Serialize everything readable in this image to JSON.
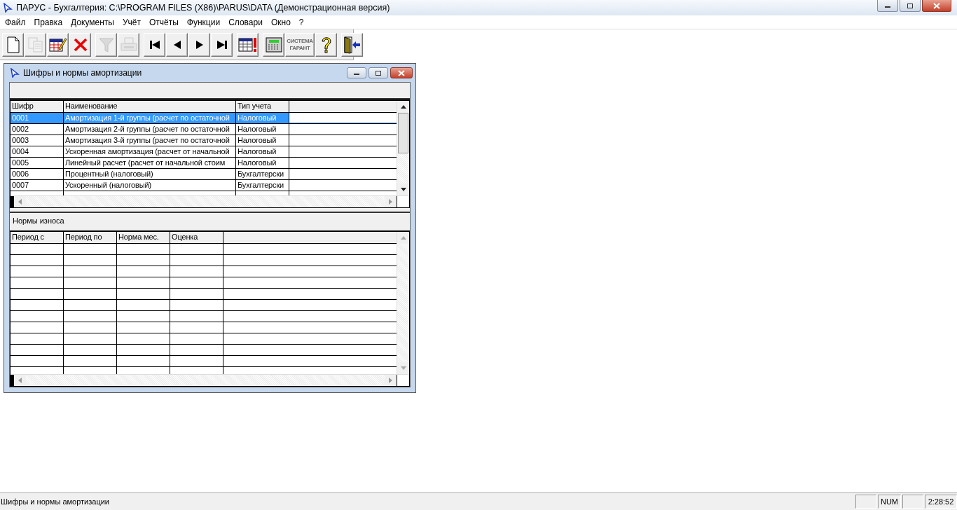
{
  "window": {
    "title": "ПАРУС - Бухгалтерия: C:\\PROGRAM FILES (X86)\\PARUS\\DATA (Демонстрационная версия)"
  },
  "menu": [
    {
      "label": "Файл"
    },
    {
      "label": "Правка"
    },
    {
      "label": "Документы"
    },
    {
      "label": "Учёт"
    },
    {
      "label": "Отчёты"
    },
    {
      "label": "Функции"
    },
    {
      "label": "Словари"
    },
    {
      "label": "Окно"
    },
    {
      "label": "?"
    }
  ],
  "toolbar": [
    [
      {
        "kind": "new",
        "disabled": false
      },
      {
        "kind": "copy",
        "disabled": true
      },
      {
        "kind": "edit",
        "disabled": false
      },
      {
        "kind": "delete",
        "disabled": false
      }
    ],
    [
      {
        "kind": "filter",
        "disabled": true
      },
      {
        "kind": "print",
        "disabled": true
      }
    ],
    [
      {
        "kind": "first",
        "disabled": false
      },
      {
        "kind": "prev",
        "disabled": false
      },
      {
        "kind": "next",
        "disabled": false
      },
      {
        "kind": "last",
        "disabled": false
      }
    ],
    [
      {
        "kind": "alert",
        "disabled": false
      }
    ],
    [
      {
        "kind": "calculator",
        "disabled": false
      },
      {
        "kind": "garant",
        "disabled": true,
        "label_lines": [
          "СИСТЕМА",
          "ГАРАНТ"
        ]
      },
      {
        "kind": "help",
        "disabled": false
      }
    ],
    [
      {
        "kind": "exit",
        "disabled": false
      }
    ]
  ],
  "child_window": {
    "title": "Шифры и нормы амортизации",
    "table": {
      "columns": [
        {
          "label": "Шифр"
        },
        {
          "label": "Наименование"
        },
        {
          "label": "Тип учета"
        }
      ],
      "rows": [
        {
          "cells": [
            "0001",
            "Амортизация 1-й группы (расчет по остаточной",
            "Налоговый"
          ],
          "selected": true
        },
        {
          "cells": [
            "0002",
            "Амортизация 2-й группы (расчет по остаточной",
            "Налоговый"
          ],
          "selected": false
        },
        {
          "cells": [
            "0003",
            "Амортизация 3-й группы (расчет по остаточной",
            "Налоговый"
          ],
          "selected": false
        },
        {
          "cells": [
            "0004",
            "Ускоренная амортизация (расчет от начальной",
            "Налоговый"
          ],
          "selected": false
        },
        {
          "cells": [
            "0005",
            "Линейный расчет (расчет от начальной стоим",
            "Налоговый"
          ],
          "selected": false
        },
        {
          "cells": [
            "0006",
            "Процентный (налоговый)",
            "Бухгалтерски"
          ],
          "selected": false
        },
        {
          "cells": [
            "0007",
            "Ускоренный (налоговый)",
            "Бухгалтерски"
          ],
          "selected": false
        }
      ]
    },
    "section_label": "Нормы износа",
    "norms_table": {
      "columns": [
        {
          "label": "Период с"
        },
        {
          "label": "Период по"
        },
        {
          "label": "Норма мес."
        },
        {
          "label": "Оценка"
        }
      ]
    }
  },
  "status_bar": {
    "text": "Шифры и нормы амортизации",
    "panels": [
      {
        "kind": "blank"
      },
      {
        "kind": "text",
        "text": "NUM"
      },
      {
        "kind": "blank"
      },
      {
        "kind": "text",
        "text": "2:28:52"
      }
    ]
  }
}
